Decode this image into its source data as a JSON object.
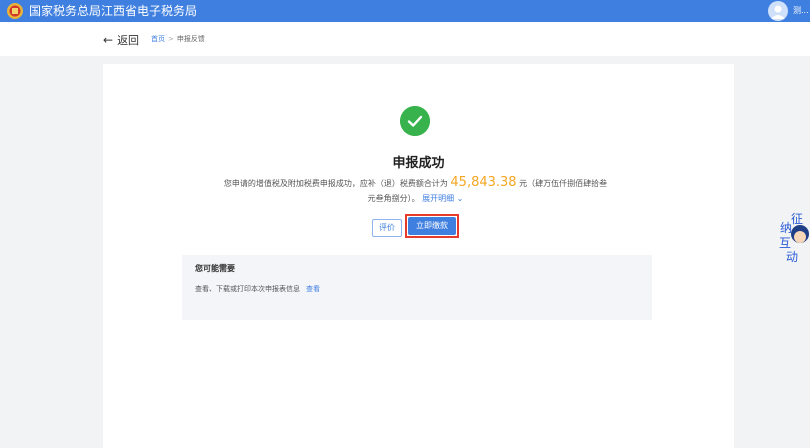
{
  "header": {
    "title": "国家税务总局江西省电子税务局",
    "user": "测..."
  },
  "breadcrumb": {
    "back_label": "返回",
    "items": [
      "首页",
      "申报反馈"
    ],
    "separator": ">"
  },
  "result": {
    "title": "申报成功",
    "message_prefix": "您申请的增值税及附加税费申报成功，应补（退）税费额合计为",
    "amount": "45,843.38",
    "message_suffix": "元（肆万伍仟捌佰肆拾叁元叁角捌分）。",
    "expand_label": "展开明细 ⌄"
  },
  "actions": {
    "rate_label": "评价",
    "pay_label": "立即缴款"
  },
  "suggest": {
    "title": "您可能需要",
    "text": "查看、下载或打印本次申报表信息",
    "link_label": "查看"
  },
  "mascot": {
    "text": [
      "征",
      "纳",
      "互",
      "动"
    ]
  },
  "colors": {
    "primary": "#3f7fe0",
    "success": "#37b24d",
    "amount": "#f5a623",
    "highlight": "#e53b2b"
  }
}
